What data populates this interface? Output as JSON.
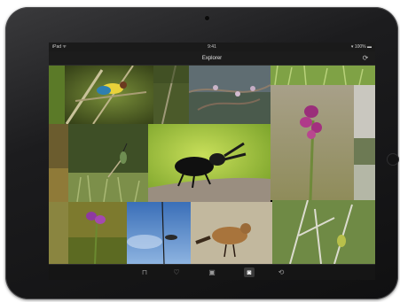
{
  "status": {
    "carrier": "iPad ᯤ",
    "time": "9:41",
    "battery": "▾ 100% ▬"
  },
  "nav": {
    "title": "Explorer",
    "refresh_icon": "refresh-icon"
  },
  "tabs": [
    {
      "name": "tab-library",
      "icon": "library-icon",
      "glyph": "⊓",
      "active": false
    },
    {
      "name": "tab-favorites",
      "icon": "heart-icon",
      "glyph": "♡",
      "active": false
    },
    {
      "name": "tab-albums",
      "icon": "album-icon",
      "glyph": "▣",
      "active": false
    },
    {
      "name": "tab-explore",
      "icon": "explore-icon",
      "glyph": "◙",
      "active": true
    },
    {
      "name": "tab-sync",
      "icon": "sync-icon",
      "glyph": "⟲",
      "active": false
    }
  ],
  "photos": [
    {
      "name": "photo-bee-eater-branch",
      "subject": "bird"
    },
    {
      "name": "photo-hazy-woodland",
      "subject": "landscape"
    },
    {
      "name": "photo-blossom-branches",
      "subject": "plant"
    },
    {
      "name": "photo-grass-strip",
      "subject": "grass"
    },
    {
      "name": "photo-orchid-tall",
      "subject": "orchid"
    },
    {
      "name": "photo-edge-right",
      "subject": "blur"
    },
    {
      "name": "photo-hummingbird",
      "subject": "bird"
    },
    {
      "name": "photo-stag-beetle",
      "subject": "insect"
    },
    {
      "name": "photo-pink-orchid-small",
      "subject": "orchid"
    },
    {
      "name": "photo-sky-reed",
      "subject": "bird"
    },
    {
      "name": "photo-wheatear",
      "subject": "bird"
    },
    {
      "name": "photo-white-branches",
      "subject": "plant"
    }
  ]
}
